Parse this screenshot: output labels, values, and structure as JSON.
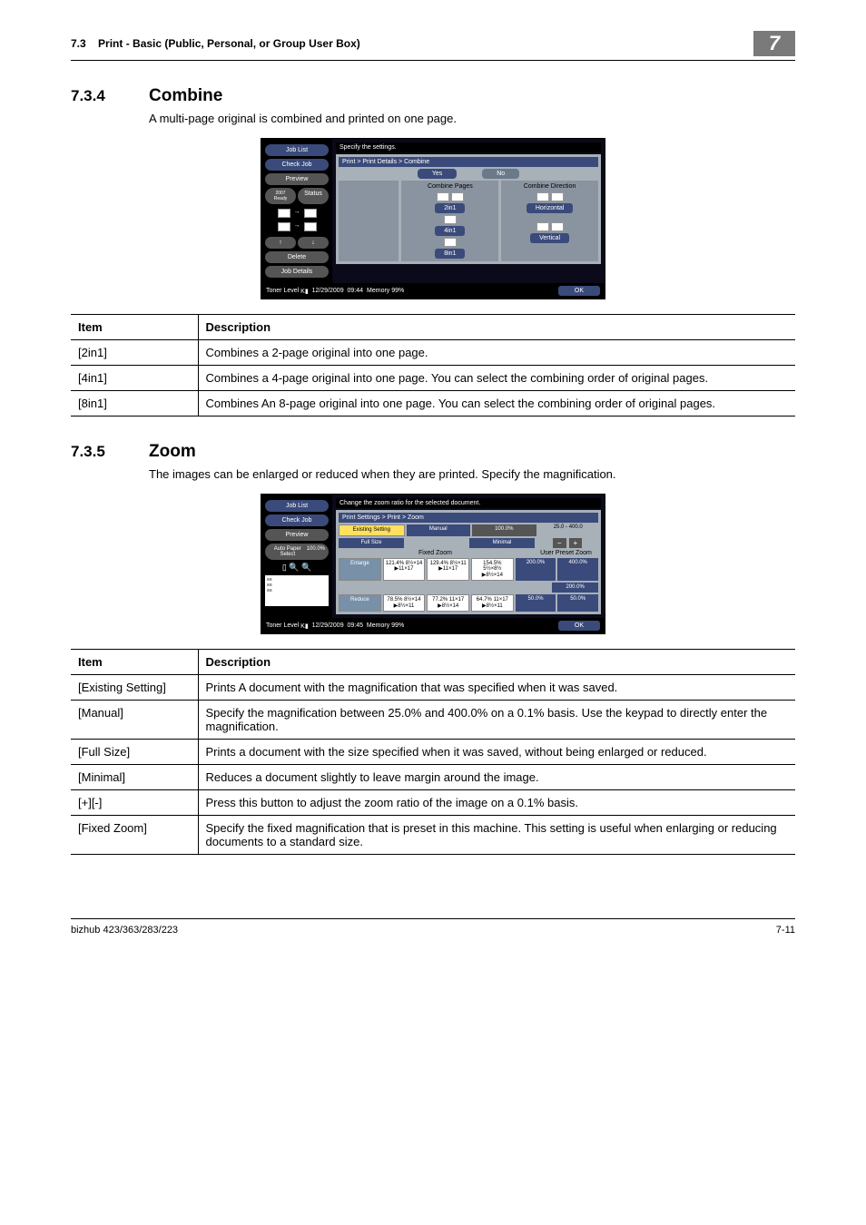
{
  "header": {
    "section_no": "7.3",
    "section_title": "Print - Basic (Public, Personal, or Group User Box)",
    "chapter": "7"
  },
  "s1": {
    "num": "7.3.4",
    "title": "Combine",
    "intro": "A multi-page original is combined and printed on one page.",
    "ss": {
      "top_msg": "Specify the settings.",
      "job_list": "Job List",
      "check_job": "Check Job",
      "preview": "Preview",
      "status": "Status",
      "delete": "Delete",
      "job_details": "Job Details",
      "breadcrumb": "Print > Print Details > Combine",
      "yes": "Yes",
      "no": "No",
      "combine_pages": "Combine Pages",
      "combine_direction": "Combine Direction",
      "b2in1": "2in1",
      "b4in1": "4in1",
      "b8in1": "8in1",
      "horizontal": "Horizontal",
      "vertical": "Vertical",
      "toner": "Toner Level",
      "date": "12/29/2009",
      "time": "09:44",
      "memory": "Memory",
      "mem_pct": "99%",
      "ok": "OK"
    },
    "table": {
      "h_item": "Item",
      "h_desc": "Description",
      "rows": [
        {
          "item": "[2in1]",
          "desc": "Combines a 2-page original into one page."
        },
        {
          "item": "[4in1]",
          "desc": "Combines a 4-page original into one page. You can select the combining order of original pages."
        },
        {
          "item": "[8in1]",
          "desc": "Combines An 8-page original into one page. You can select the combining order of original pages."
        }
      ]
    }
  },
  "s2": {
    "num": "7.3.5",
    "title": "Zoom",
    "intro": "The images can be enlarged or reduced when they are printed. Specify the magnification.",
    "ss": {
      "top_msg": "Change the zoom ratio for the selected document.",
      "job_list": "Job List",
      "check_job": "Check Job",
      "preview": "Preview",
      "auto_paper": "Auto Paper Select",
      "pct100": "100.0%",
      "breadcrumb": "Print Settings > Print > Zoom",
      "existing": "Existing Setting",
      "manual": "Manual",
      "full_size": "Full Size",
      "minimal": "Minimal",
      "range_lo": "25.0",
      "dash": "-",
      "range_hi": "400.0",
      "minus": "−",
      "plus": "+",
      "fixed_zoom": "Fixed Zoom",
      "user_preset": "User Preset Zoom",
      "enlarge": "Enlarge",
      "reduce": "Reduce",
      "e1": "121.4%\n8½×14\n▶11×17",
      "e2": "129.4%\n8½×11\n▶11×17",
      "e3": "154.5%\n5½×8½\n▶8½×14",
      "e_big": "200.0%",
      "r1": "78.5%\n8½×14\n▶8½×11",
      "r2": "77.2%\n11×17\n▶8½×14",
      "r3": "64.7%\n11×17\n▶8½×11",
      "r_small": "50.0%",
      "up400": "400.0%",
      "up200": "200.0%",
      "up50": "50.0%",
      "toner": "Toner Level",
      "date": "12/29/2009",
      "time": "09:45",
      "memory": "Memory",
      "mem_pct": "99%",
      "ok": "OK"
    },
    "table": {
      "h_item": "Item",
      "h_desc": "Description",
      "rows": [
        {
          "item": "[Existing Setting]",
          "desc": "Prints A document with the magnification that was specified when it was saved."
        },
        {
          "item": "[Manual]",
          "desc": "Specify the magnification between 25.0% and 400.0% on a 0.1% basis. Use the keypad to directly enter the magnification."
        },
        {
          "item": "[Full Size]",
          "desc": "Prints a document with the size specified when it was saved, without being enlarged or reduced."
        },
        {
          "item": "[Minimal]",
          "desc": "Reduces a document slightly to leave margin around the image."
        },
        {
          "item": "[+][-]",
          "desc": "Press this button to adjust the zoom ratio of the image on a 0.1% basis."
        },
        {
          "item": "[Fixed Zoom]",
          "desc": "Specify the fixed magnification that is preset in this machine. This setting is useful when enlarging or reducing documents to a standard size."
        }
      ]
    }
  },
  "footer": {
    "model": "bizhub 423/363/283/223",
    "page": "7-11"
  }
}
